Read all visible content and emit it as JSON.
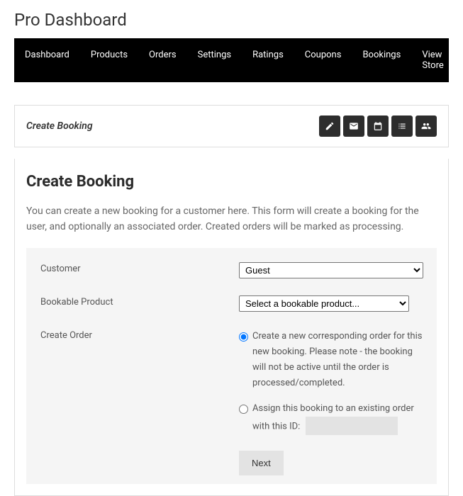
{
  "pageTitle": "Pro Dashboard",
  "nav": {
    "items": [
      "Dashboard",
      "Products",
      "Orders",
      "Settings",
      "Ratings",
      "Coupons",
      "Bookings",
      "View Store"
    ]
  },
  "panel": {
    "title": "Create Booking"
  },
  "content": {
    "title": "Create Booking",
    "description": "You can create a new booking for a customer here. This form will create a booking for the user, and optionally an associated order. Created orders will be marked as processing."
  },
  "form": {
    "customerLabel": "Customer",
    "customerValue": "Guest",
    "productLabel": "Bookable Product",
    "productValue": "Select a bookable product...",
    "orderLabel": "Create Order",
    "optionNew": "Create a new corresponding order for this new booking. Please note - the booking will not be active until the order is processed/completed.",
    "optionExisting": "Assign this booking to an existing order with this ID:",
    "nextLabel": "Next"
  }
}
